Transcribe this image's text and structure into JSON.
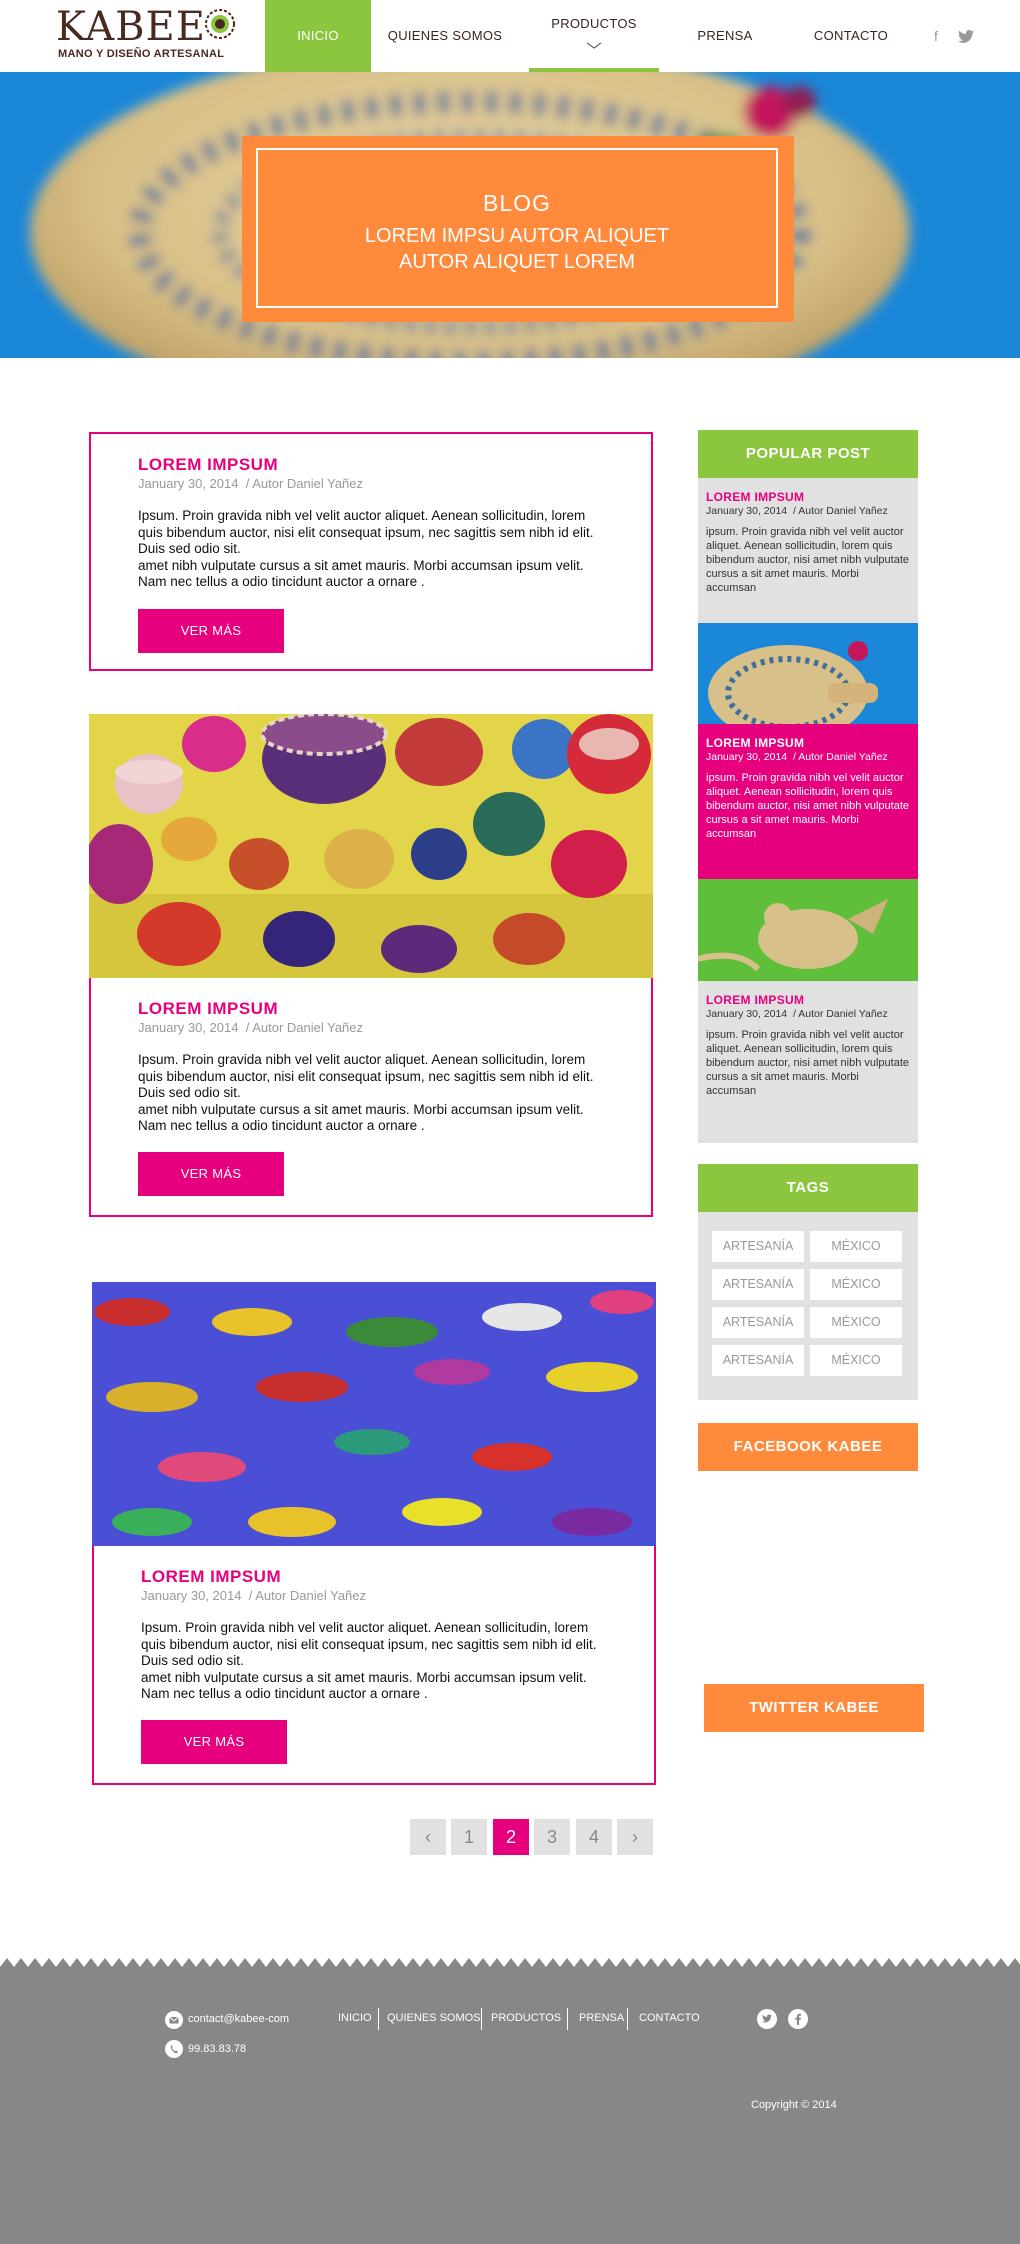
{
  "brand": {
    "name": "KABEE",
    "tagline": "MANO Y DISEÑO ARTESANAL"
  },
  "nav": {
    "items": [
      {
        "label": "INICIO"
      },
      {
        "label": "QUIENES SOMOS"
      },
      {
        "label": "PRODUCTOS"
      },
      {
        "label": "PRENSA"
      },
      {
        "label": "CONTACTO"
      }
    ],
    "social": {
      "facebook": "f",
      "twitter": "twitter-icon"
    }
  },
  "hero": {
    "title": "BLOG",
    "subtitle": "LOREM IMPSU AUTOR ALIQUET AUTOR ALIQUET LOREM"
  },
  "posts": [
    {
      "title": "LOREM IMPSUM",
      "date": "January 30, 2014",
      "author": "/ Autor Daniel Yañez",
      "body1": "Ipsum. Proin gravida nibh vel velit auctor aliquet. Aenean sollicitudin, lorem quis bibendum auctor, nisi elit consequat ipsum, nec sagittis sem nibh id elit. Duis sed odio sit.",
      "body2": " amet nibh vulputate cursus a sit amet mauris. Morbi accumsan ipsum velit. Nam nec tellus a odio tincidunt auctor a ornare .",
      "button": "VER MÁS"
    },
    {
      "title": "LOREM IMPSUM",
      "date": "January 30, 2014",
      "author": "/ Autor Daniel Yañez",
      "body1": "Ipsum. Proin gravida nibh vel velit auctor aliquet. Aenean sollicitudin, lorem quis bibendum auctor, nisi elit consequat ipsum, nec sagittis sem nibh id elit. Duis sed odio sit.",
      "body2": " amet nibh vulputate cursus a sit amet mauris. Morbi accumsan ipsum velit. Nam nec tellus a odio tincidunt auctor a ornare .",
      "button": "VER MÁS"
    },
    {
      "title": "LOREM IMPSUM",
      "date": "January 30, 2014",
      "author": "/ Autor Daniel Yañez",
      "body1": "Ipsum. Proin gravida nibh vel velit auctor aliquet. Aenean sollicitudin, lorem quis bibendum auctor, nisi elit consequat ipsum, nec sagittis sem nibh id elit. Duis sed odio sit.",
      "body2": " amet nibh vulputate cursus a sit amet mauris. Morbi accumsan ipsum velit. Nam nec tellus a odio tincidunt auctor a ornare .",
      "button": "VER MÁS"
    }
  ],
  "pagination": {
    "prev": "‹",
    "pages": [
      "1",
      "2",
      "3",
      "4"
    ],
    "current": "2",
    "next": "›"
  },
  "sidebar": {
    "popular_title": "POPULAR POST",
    "popular": [
      {
        "title": "LOREM IMPSUM",
        "date": "January 30, 2014",
        "author": "/ Autor Daniel Yañez",
        "body": "ipsum. Proin gravida nibh vel velit auctor aliquet. Aenean sollicitudin, lorem quis bibendum auctor, nisi  amet nibh vulputate cursus a sit amet mauris. Morbi accumsan"
      },
      {
        "title": "LOREM IMPSUM",
        "date": "January 30, 2014",
        "author": "/ Autor Daniel Yañez",
        "body": "ipsum. Proin gravida nibh vel velit auctor aliquet. Aenean sollicitudin, lorem quis bibendum auctor, nisi  amet nibh vulputate cursus a sit amet mauris. Morbi accumsan"
      },
      {
        "title": "LOREM IMPSUM",
        "date": "January 30, 2014",
        "author": "/ Autor Daniel Yañez",
        "body": "ipsum. Proin gravida nibh vel velit auctor aliquet. Aenean sollicitudin, lorem quis bibendum auctor, nisi  amet nibh vulputate cursus a sit amet mauris. Morbi accumsan"
      }
    ],
    "tags_title": "TAGS",
    "tags": [
      "ARTESANÍA",
      "MÉXICO",
      "ARTESANÍA",
      "MÉXICO",
      "ARTESANÍA",
      "MÉXICO",
      "ARTESANÍA",
      "MÉXICO"
    ],
    "facebook_title": "FACEBOOK KABEE",
    "twitter_title": "TWITTER KABEE"
  },
  "footer": {
    "email": "contact@kabee-com",
    "phone": "99.83.83.78",
    "links": [
      "INICIO",
      "QUIENES SOMOS",
      "PRODUCTOS",
      "PRENSA",
      "CONTACTO"
    ],
    "copyright": "Copyright © 2014"
  },
  "colors": {
    "green": "#8cc63f",
    "pink": "#e6007e",
    "orange": "#ff8a3c",
    "sidebar_grey": "#e1e1e1",
    "footer_grey": "#87878a",
    "hero_blue": "#1b87d8"
  }
}
